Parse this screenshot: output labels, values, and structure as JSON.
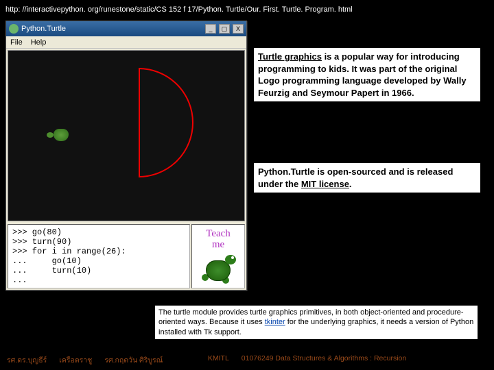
{
  "url": "http: //interactivepython. org/runestone/static/CS 152 f 17/Python. Turtle/Our. First. Turtle. Program. html",
  "window": {
    "title": "Python.Turtle",
    "menu": {
      "file": "File",
      "help": "Help"
    },
    "buttons": {
      "min": "_",
      "max": "▢",
      "close": "X"
    }
  },
  "console": {
    "lines": ">>> go(80)\n>>> turn(90)\n>>> for i in range(26):\n...     go(10)\n...     turn(10)\n..."
  },
  "teach": {
    "line1": "Teach",
    "line2": "me"
  },
  "para1": {
    "lead": "Turtle graphics",
    "rest": " is a popular way for introducing programming to kids. It was part of the original Logo programming language developed by Wally Feurzig and Seymour Papert in 1966."
  },
  "para2": {
    "lead": "Python.Turtle is open-sourced and is released under the ",
    "link": "MIT license",
    "tail": "."
  },
  "blurb": {
    "a": "The turtle module provides turtle graphics primitives, in both object-oriented and procedure-oriented ways. Because it uses ",
    "link": "tkinter",
    "b": " for the underlying graphics, it needs a version of Python installed with Tk support."
  },
  "footer": {
    "a": "รศ.ดร.บุญธีร์",
    "b": "เครือตราชู",
    "c": "รศ.กฤตวัน  ศิริบูรณ์",
    "d": "KMITL",
    "e": "01076249 Data Structures & Algorithms : Recursion"
  }
}
